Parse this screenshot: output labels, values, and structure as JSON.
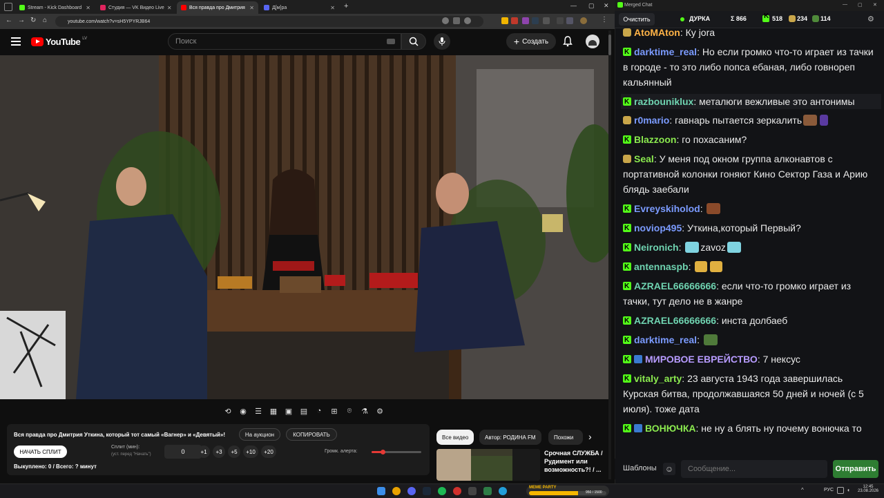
{
  "browser": {
    "tabs": [
      {
        "title": "Stream - Kick Dashboard",
        "color": "#53fc18"
      },
      {
        "title": "Студия — VK Видео Live",
        "color": "#e0245e"
      },
      {
        "title": "Вся правда про Дмитрия Уткина",
        "color": "#ff0000"
      },
      {
        "title": "Д[м]ра",
        "color": "#5865f2"
      }
    ],
    "url": "youtube.com/watch?v=sH5YPYRJB64",
    "new_tab": "+"
  },
  "youtube": {
    "logo": "YouTube",
    "country": "LV",
    "search_placeholder": "Поиск",
    "create_label": "Создать"
  },
  "panel": {
    "title": "Вся правда про Дмитрия Уткина, который тот самый «Вагнер» и «Девятый»!",
    "auction_btn": "На аукцион",
    "copy_btn": "КОПИРОВАТЬ",
    "start_split_btn": "НАЧАТЬ СПЛИТ",
    "split_label": "Сплит (мин):",
    "split_hint": "(уст. перед \"Начать\")",
    "split_value": "0",
    "inc_buttons": [
      "+1",
      "+3",
      "+5",
      "+10",
      "+20"
    ],
    "alert_volume_label": "Громк. алерта:",
    "alert_volume": 0.22,
    "bought_text": "Выкуплено: 0 / Всего: ? минут"
  },
  "related": {
    "chips": [
      "Все видео",
      "Автор: РОДИНА FM",
      "Похожи"
    ],
    "video_title": "Срочная СЛУЖБА / Рудимент или возможность?! / ..."
  },
  "chat": {
    "window_title": "Merged Chat",
    "clear_btn": "Очистить",
    "stream_name": "ДУРКА",
    "sum_label": "Σ 866",
    "kick_count": "518",
    "yt_count": "234",
    "vk_count": "114",
    "messages": [
      {
        "badge": "yt",
        "user": "AtoMAton",
        "color": "#ffb347",
        "text": "Ку jora"
      },
      {
        "badge": "kick",
        "user": "darktime_real",
        "color": "#7b9bff",
        "text": "Но если громко что-то играет из тачки в городе - то это либо попса ебаная, либо говнореп кальянный"
      },
      {
        "badge": "kick",
        "user": "razbouniklux",
        "color": "#6fd3b0",
        "text": "металюги вежливые это антонимы"
      },
      {
        "badge": "yt",
        "user": "r0mario",
        "color": "#7b9bff",
        "text": "гавнарь пытается зеркалить"
      },
      {
        "badge": "kick",
        "user": "Blazzoon",
        "color": "#8bea4f",
        "text": "го похасаним?"
      },
      {
        "badge": "yt",
        "user": "Seal",
        "color": "#8bea4f",
        "text": "У меня под окном группа алконавтов с портативной колонки гоняют Кино Сектор Газа и Арию блядь заебали"
      },
      {
        "badge": "kick",
        "user": "Evreyskiholod",
        "color": "#7b9bff",
        "text": ""
      },
      {
        "badge": "kick",
        "user": "noviop495",
        "color": "#7b9bff",
        "text": "Уткина,который Первый?"
      },
      {
        "badge": "kick",
        "user": "Neironich",
        "color": "#6fd3b0",
        "text": "zavoz"
      },
      {
        "badge": "kick",
        "user": "antennaspb",
        "color": "#6fd3b0",
        "text": ""
      },
      {
        "badge": "kick",
        "user": "AZRAEL66666666",
        "color": "#6fd3b0",
        "text": "если что-то громко играет из тачки, тут дело не в жанре"
      },
      {
        "badge": "kick",
        "user": "AZRAEL66666666",
        "color": "#6fd3b0",
        "text": "инста долбаеб"
      },
      {
        "badge": "kick",
        "user": "darktime_real",
        "color": "#7b9bff",
        "text": ""
      },
      {
        "badge": "kick",
        "user": "МИРОВОЕ ЕВРЕЙСТВО",
        "color": "#b79bff",
        "text": "7 нексус"
      },
      {
        "badge": "kick",
        "user": "vitaly_arty",
        "color": "#8bea4f",
        "text": "23 августа 1943 года завершилась Курская битва, продолжавшаяся 50 дней и ночей (с 5 июля). тоже дата"
      },
      {
        "badge": "kick",
        "user": "ВОНЮЧКА",
        "color": "#8bea4f",
        "text": "не ну а блять ну почему вонючка то"
      }
    ],
    "templates_btn": "Шаблоны",
    "input_placeholder": "Сообщение...",
    "send_btn": "Отправить"
  },
  "taskbar": {
    "lang": "РУС",
    "time": "12:45",
    "date": "23.08.2026",
    "meme_party": "MEME PARTY",
    "meme_progress": "950 / 1500"
  },
  "colors": {
    "accent_kick": "#53fc18",
    "send": "#2e7d32",
    "yt_red": "#ff0000"
  }
}
